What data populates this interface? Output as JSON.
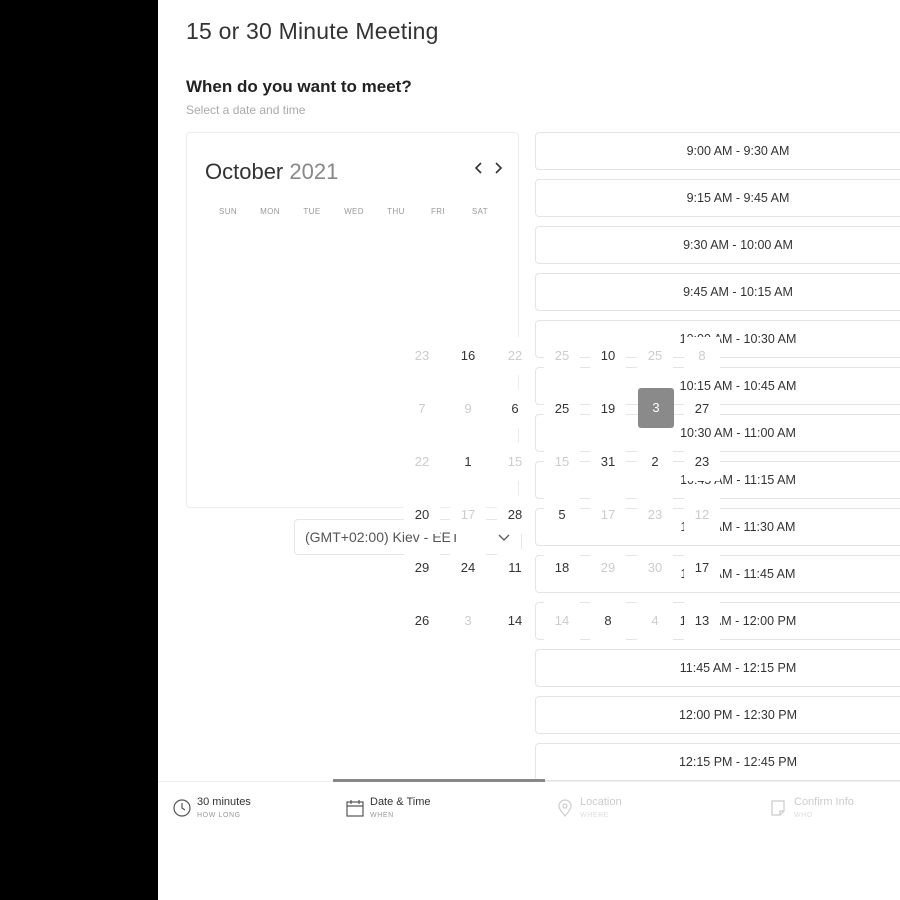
{
  "meeting": {
    "title": "15 or 30 Minute Meeting",
    "question": "When do you want to meet?",
    "instruction": "Select a date and time"
  },
  "calendar": {
    "month": "October",
    "year": "2021",
    "prev_icon": "chevron-left-icon",
    "next_icon": "chevron-right-icon",
    "weekdays": [
      "SUN",
      "MON",
      "TUE",
      "WED",
      "THU",
      "FRI",
      "SAT"
    ],
    "selected_date": "3",
    "dates": [
      [
        "23",
        "16",
        "22",
        "25",
        "10",
        "25",
        "8"
      ],
      [
        "7",
        "9",
        "6",
        "25",
        "19",
        "3",
        "27"
      ],
      [
        "22",
        "1",
        "15",
        "15",
        "31",
        "2",
        "23"
      ],
      [
        "20",
        "17",
        "28",
        "5",
        "17",
        "23",
        "12"
      ],
      [
        "29",
        "24",
        "11",
        "18",
        "29",
        "30",
        "17"
      ],
      [
        "26",
        "3",
        "14",
        "14",
        "8",
        "4",
        "13"
      ]
    ]
  },
  "timezone": {
    "label": "(GMT+02:00) Kiev - EET",
    "icon": "chevron-down-icon"
  },
  "time_slots": [
    "9:00 AM - 9:30 AM",
    "9:15 AM - 9:45 AM",
    "9:30 AM - 10:00 AM",
    "9:45 AM - 10:15 AM",
    "10:00 AM - 10:30 AM",
    "10:15 AM - 10:45 AM",
    "10:30 AM - 11:00 AM",
    "10:45 AM - 11:15 AM",
    "11:00 AM - 11:30 AM",
    "11:15 AM - 11:45 AM",
    "11:30 AM - 12:00 PM",
    "11:45 AM - 12:15 PM",
    "12:00 PM - 12:30 PM",
    "12:15 PM - 12:45 PM"
  ],
  "steps": [
    {
      "title": "30 minutes",
      "subtitle": "HOW LONG",
      "icon": "clock-icon"
    },
    {
      "title": "Date & Time",
      "subtitle": "WHEN",
      "icon": "calendar-icon"
    },
    {
      "title": "Location",
      "subtitle": "WHERE",
      "icon": "map-pin-icon"
    },
    {
      "title": "Confirm Info",
      "subtitle": "WHO",
      "icon": "document-icon"
    }
  ],
  "colors": {
    "selected_date": "#8a8a8a",
    "progress": "#888888"
  }
}
